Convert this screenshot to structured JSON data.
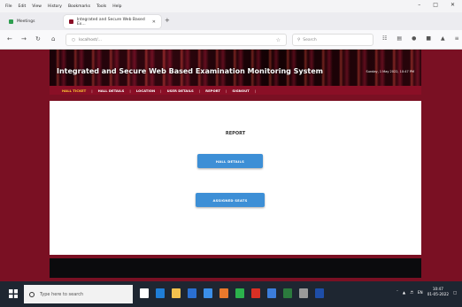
{
  "browser": {
    "menu": [
      "File",
      "Edit",
      "View",
      "History",
      "Bookmarks",
      "Tools",
      "Help"
    ],
    "tabs": [
      {
        "label": "Meetings",
        "icon": "meet-icon",
        "active": false
      },
      {
        "label": "Integrated and Secure Web Based Ex...",
        "icon": "page-icon",
        "active": true
      }
    ],
    "url": "localhost/...",
    "search_placeholder": "Search"
  },
  "site": {
    "title": "Integrated and Secure Web Based Examination Monitoring System",
    "datetime": "Sunday, 1 May 2022, 10:47 PM",
    "nav": [
      {
        "label": "HALL TICKET",
        "current": true
      },
      {
        "label": "HALL DETAILS",
        "current": false
      },
      {
        "label": "LOCATION",
        "current": false
      },
      {
        "label": "USER DETAILS",
        "current": false
      },
      {
        "label": "REPORT",
        "current": false
      },
      {
        "label": "SIGNOUT",
        "current": false
      }
    ]
  },
  "report": {
    "heading": "REPORT",
    "buttons": [
      {
        "label": "HALL DETAILS"
      },
      {
        "label": "ASSIGNED SEATS"
      }
    ]
  },
  "taskbar": {
    "search_placeholder": "Type here to search",
    "time": "10:47",
    "date": "01-05-2022"
  },
  "colors": {
    "page_background": "#7a1023",
    "button": "#3d8fd6",
    "nav_current": "#ffcc33"
  }
}
